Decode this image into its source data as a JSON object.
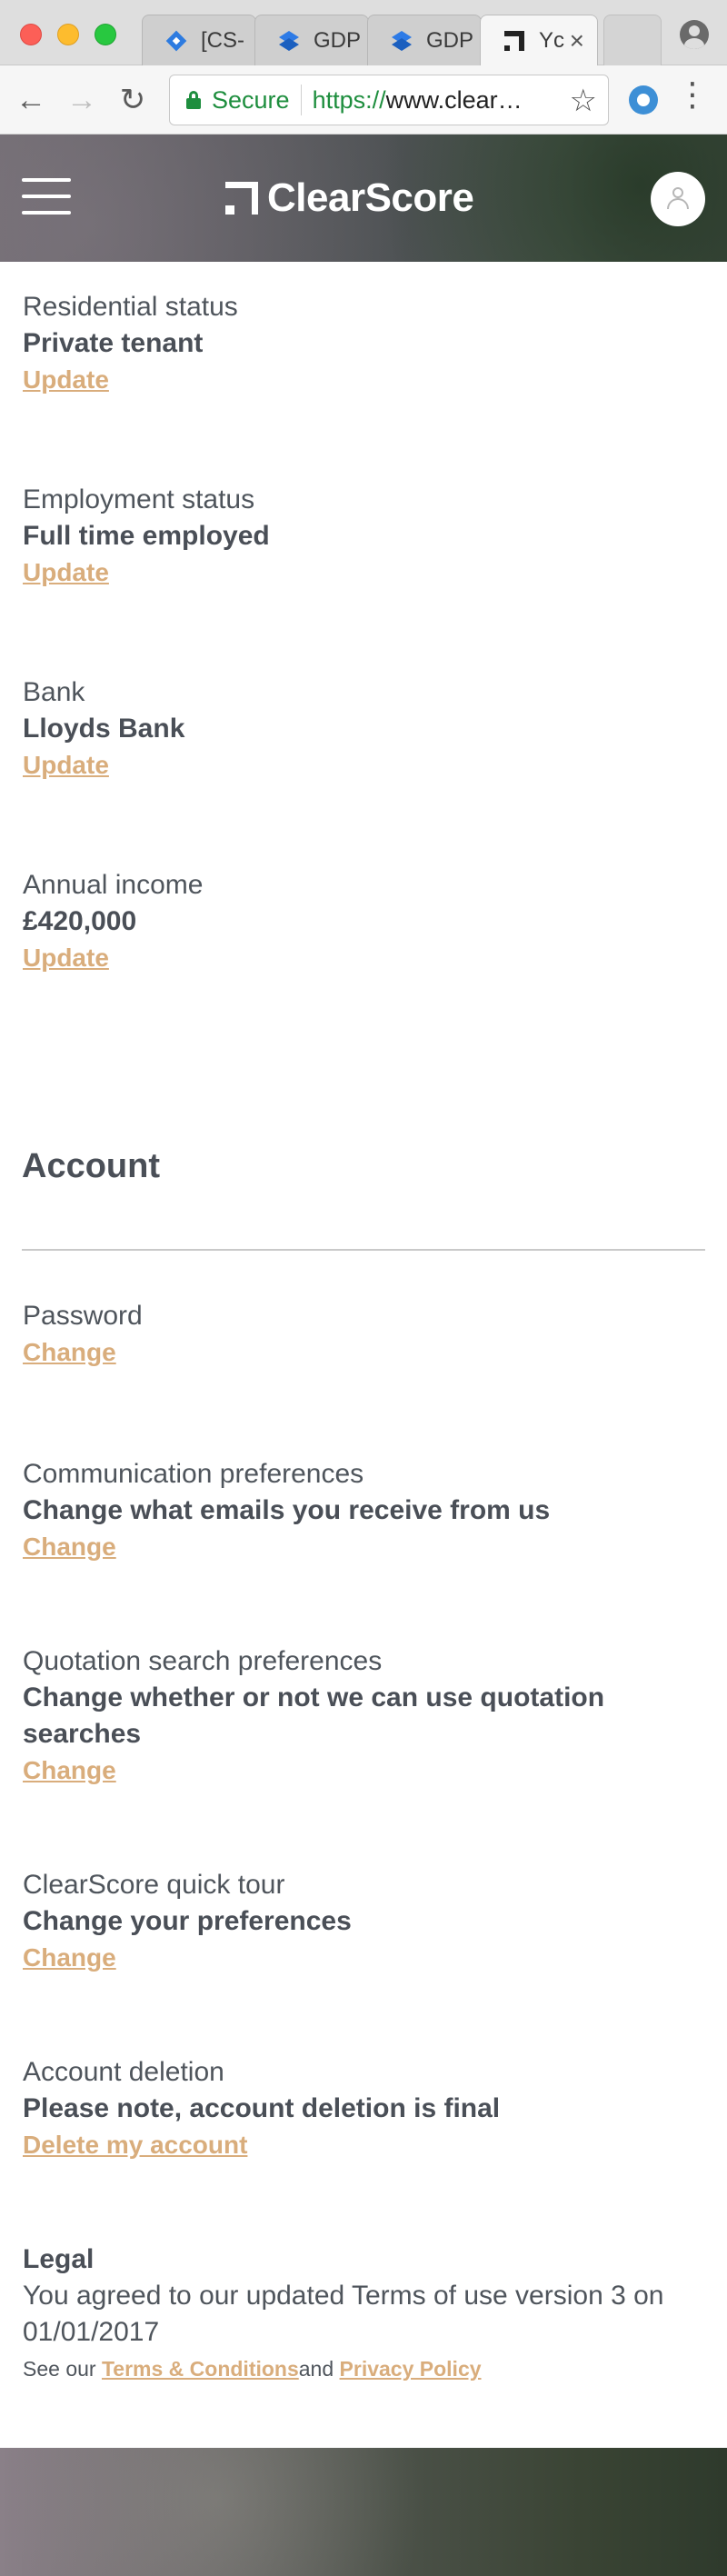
{
  "browser": {
    "tabs": [
      {
        "label": "[CS-",
        "icon": "jira-diamond-icon",
        "active": false
      },
      {
        "label": "GDP",
        "icon": "dropbox-paper-icon",
        "active": false
      },
      {
        "label": "GDP",
        "icon": "dropbox-paper-icon",
        "active": false
      },
      {
        "label": "Yc",
        "icon": "clearscore-icon",
        "active": true
      }
    ],
    "close_glyph": "×",
    "secure_label": "Secure",
    "url_scheme": "https://",
    "url_rest": "www.clear…",
    "star_glyph": "☆",
    "back_glyph": "←",
    "forward_glyph": "→",
    "reload_glyph": "↻",
    "menu_glyph": "⋮"
  },
  "header": {
    "brand": "ClearScore",
    "colors": {
      "link": "#d9ad7c",
      "text": "#4a4f57"
    }
  },
  "details": [
    {
      "label": "Residential status",
      "value": "Private tenant",
      "link": "Update"
    },
    {
      "label": "Employment status",
      "value": "Full time employed",
      "link": "Update"
    },
    {
      "label": "Bank",
      "value": "Lloyds Bank",
      "link": "Update"
    },
    {
      "label": "Annual income",
      "value": "£420,000",
      "link": "Update"
    }
  ],
  "account": {
    "title": "Account",
    "password": {
      "label": "Password",
      "link": "Change"
    },
    "communication": {
      "label": "Communication preferences",
      "value": "Change what emails you receive from us",
      "link": "Change"
    },
    "quotation": {
      "label": "Quotation search preferences",
      "value": "Change whether or not we can use quotation searches",
      "link": "Change"
    },
    "tour": {
      "label": "ClearScore quick tour",
      "value": "Change your preferences",
      "link": "Change"
    },
    "deletion": {
      "label": "Account deletion",
      "value": "Please note, account deletion is final",
      "link": "Delete my account"
    }
  },
  "legal": {
    "heading": "Legal",
    "text": "You agreed to our updated Terms of use version 3 on 01/01/2017",
    "see_our": "See our ",
    "terms": "Terms & Conditions",
    "and": "and ",
    "privacy": "Privacy Policy"
  }
}
